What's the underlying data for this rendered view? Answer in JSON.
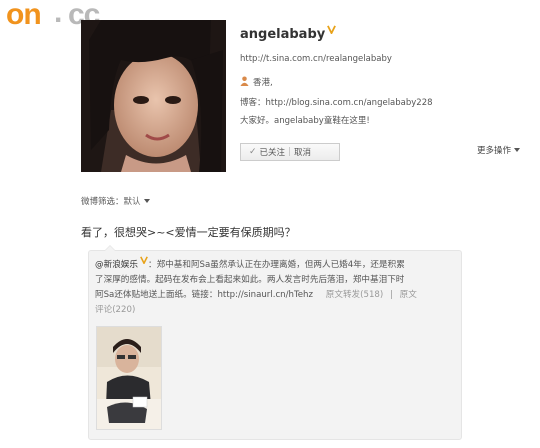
{
  "site": {
    "logo_main": "on",
    "logo_dot": ".",
    "logo_tail": "cc"
  },
  "profile": {
    "username": "angelababy",
    "url": "http://t.sina.com.cn/realangelababy",
    "location": "香港,",
    "blog_label": "博客：",
    "blog_url": "http://blog.sina.com.cn/angelababy228",
    "bio": "大家好。angelababy童鞋在这里!",
    "follow_status": "已关注",
    "cancel_label": "取消",
    "more_actions": "更多操作"
  },
  "feed": {
    "filter_label": "微博筛选：",
    "filter_value": "默认"
  },
  "post": {
    "text": "看了，很想哭>~<爱情一定要有保质期吗？"
  },
  "repost": {
    "author": "@新浪娱乐",
    "line1": "：郑中基和阿Sa虽然承认正在办理离婚，但两人已婚4年，还是积累",
    "line2": "了深厚的感情。起码在发布会上看起来如此。两人发言时先后落泪，郑中基泪下时",
    "line3": "阿Sa还体贴地送上面纸。链接：",
    "link": "http://sinaurl.cn/hTehz",
    "repost_label": "原文转发(518)",
    "comment_label": "原文",
    "comment_label2": "评论(220)"
  },
  "colors": {
    "logo_orange": "#f1931d",
    "logo_grey": "#b9b9b9",
    "repost_bg": "#f3f3f3"
  }
}
